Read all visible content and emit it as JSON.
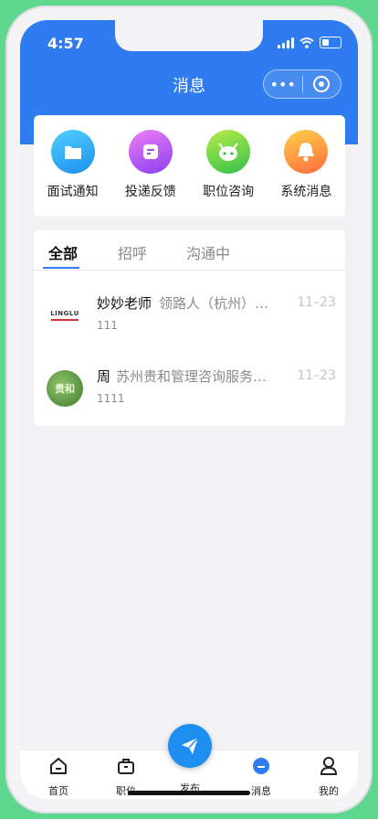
{
  "status_bar": {
    "time": "4:57"
  },
  "header": {
    "title": "消息",
    "capsule_more": "•••"
  },
  "quick_actions": [
    {
      "label": "面试通知",
      "icon": "folder-icon"
    },
    {
      "label": "投递反馈",
      "icon": "edit-icon"
    },
    {
      "label": "职位咨询",
      "icon": "robot-icon"
    },
    {
      "label": "系统消息",
      "icon": "bell-icon"
    }
  ],
  "tabs": [
    {
      "label": "全部",
      "active": true
    },
    {
      "label": "招呼",
      "active": false
    },
    {
      "label": "沟通中",
      "active": false
    }
  ],
  "messages": [
    {
      "name": "妙妙老师",
      "company": "领路人（杭州）…",
      "preview": "111",
      "date": "11–23",
      "avatar_text": "LINGLU"
    },
    {
      "name": "周",
      "company": "苏州贵和管理咨询服务…",
      "preview": "1111",
      "date": "11–23",
      "avatar_text": "贵和"
    }
  ],
  "tabbar": {
    "items": [
      {
        "label": "首页",
        "icon": "home-icon"
      },
      {
        "label": "职位",
        "icon": "briefcase-icon"
      },
      {
        "label": "发布",
        "icon": "send-icon"
      },
      {
        "label": "消息",
        "icon": "message-icon"
      },
      {
        "label": "我的",
        "icon": "profile-icon"
      }
    ]
  },
  "colors": {
    "accent": "#2f7bf0",
    "background": "#5fd88f"
  }
}
